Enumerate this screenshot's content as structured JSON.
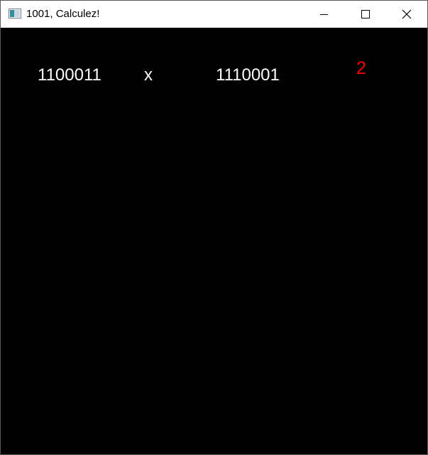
{
  "window": {
    "title": "1001, Calculez!",
    "icon": "app-window-icon",
    "controls": [
      "minimize-icon",
      "maximize-icon",
      "close-icon"
    ]
  },
  "game": {
    "operand_a": "1100011",
    "operator": "x",
    "operand_b": "1110001",
    "counter": "2",
    "colors": {
      "background": "#000000",
      "text": "#ffffff",
      "counter": "#ff0000"
    }
  }
}
